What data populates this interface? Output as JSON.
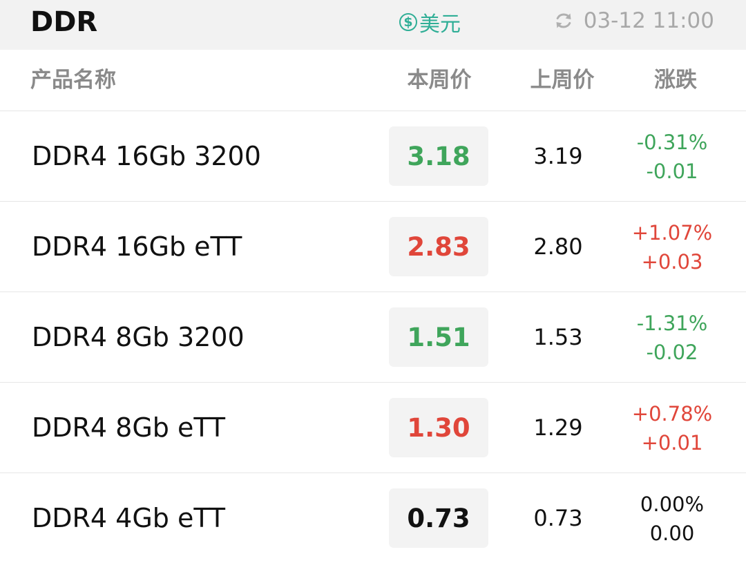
{
  "header": {
    "title": "DDR",
    "currency_symbol": "$",
    "currency_label": "美元",
    "refresh_icon": "refresh-icon",
    "updated_time": "03-12 11:00"
  },
  "columns": {
    "name": "产品名称",
    "this_week": "本周价",
    "last_week": "上周价",
    "change": "涨跌"
  },
  "colors": {
    "up": "#e0463a",
    "down": "#3fa55b",
    "flat": "#111111",
    "accent": "#2fae96"
  },
  "rows": [
    {
      "name": "DDR4 16Gb 3200",
      "this_week": "3.18",
      "last_week": "3.19",
      "change_pct": "-0.31%",
      "change_abs": "-0.01",
      "trend": "down"
    },
    {
      "name": "DDR4 16Gb eTT",
      "this_week": "2.83",
      "last_week": "2.80",
      "change_pct": "+1.07%",
      "change_abs": "+0.03",
      "trend": "up"
    },
    {
      "name": "DDR4 8Gb 3200",
      "this_week": "1.51",
      "last_week": "1.53",
      "change_pct": "-1.31%",
      "change_abs": "-0.02",
      "trend": "down"
    },
    {
      "name": "DDR4 8Gb eTT",
      "this_week": "1.30",
      "last_week": "1.29",
      "change_pct": "+0.78%",
      "change_abs": "+0.01",
      "trend": "up"
    },
    {
      "name": "DDR4 4Gb eTT",
      "this_week": "0.73",
      "last_week": "0.73",
      "change_pct": "0.00%",
      "change_abs": "0.00",
      "trend": "flat"
    }
  ]
}
